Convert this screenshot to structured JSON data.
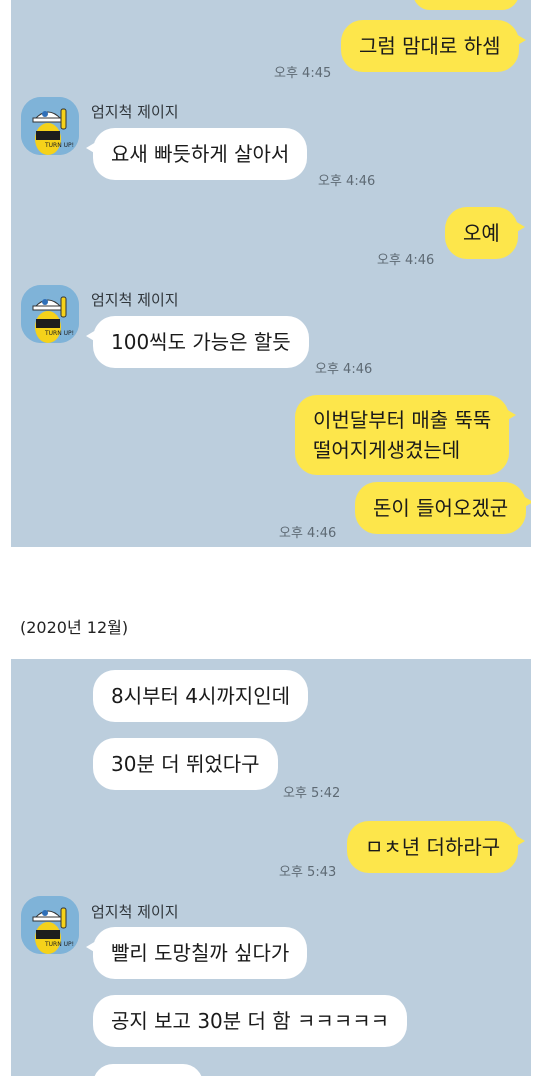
{
  "colors": {
    "chat_bg": "#bccedd",
    "my_bubble": "#fde64b",
    "other_bubble": "#ffffff",
    "avatar_bg": "#7fb3d8"
  },
  "section1": {
    "m1": {
      "text": "그럼 맘대로 하셈",
      "time": "오후 4:45"
    },
    "s1": {
      "sender": "엄지척 제이지",
      "avatar_text": "TURN UP!"
    },
    "m2": {
      "text": "요새 빠듯하게 살아서",
      "time": "오후 4:46"
    },
    "m3": {
      "text": "오예",
      "time": "오후 4:46"
    },
    "s2": {
      "sender": "엄지척 제이지",
      "avatar_text": "TURN UP!"
    },
    "m4": {
      "text": "100씩도 가능은 할듯",
      "time": "오후 4:46"
    },
    "m5": {
      "line1": "이번달부터 매출 뚝뚝",
      "line2": "떨어지게생겼는데"
    },
    "m6": {
      "text": "돈이 들어오겠군",
      "time": "오후 4:46"
    }
  },
  "date_label": "(2020년 12월)",
  "section2": {
    "m7": {
      "text": "8시부터 4시까지인데"
    },
    "m8": {
      "text": "30분 더 뛰었다구",
      "time": "오후 5:42"
    },
    "m9": {
      "text": "ㅁㅊ년 더하라구",
      "time": "오후 5:43"
    },
    "s3": {
      "sender": "엄지척 제이지",
      "avatar_text": "TURN UP!"
    },
    "m10": {
      "text": "빨리 도망칠까 싶다가"
    },
    "m11": {
      "text": "공지 보고 30분 더 함 ㅋㅋㅋㅋㅋ"
    }
  }
}
